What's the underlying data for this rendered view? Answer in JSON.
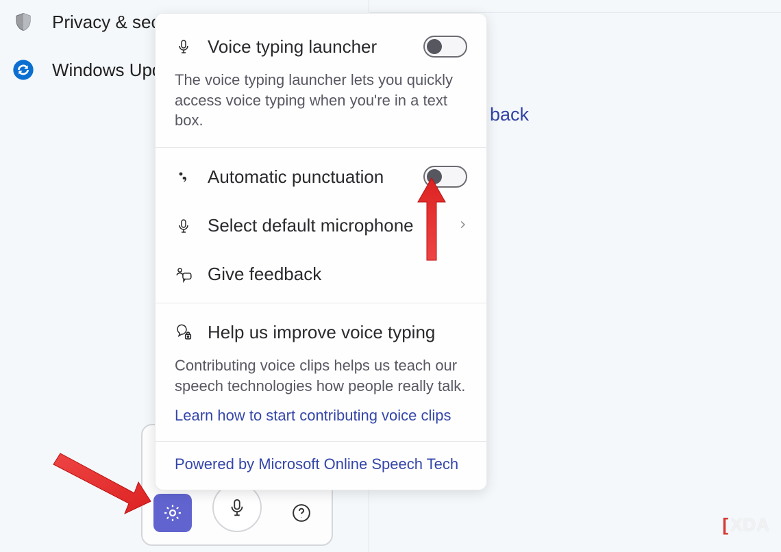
{
  "sidebar": {
    "privacy_label": "Privacy & security",
    "update_label": "Windows Update"
  },
  "back_link_fragment": "back",
  "voice_bar": {
    "settings_name": "gear-icon",
    "mic_name": "microphone-icon",
    "help_name": "question-mark-icon"
  },
  "popup": {
    "voice_launcher": {
      "title": "Voice typing launcher",
      "desc": "The voice typing launcher lets you quickly access voice typing when you're in a text box.",
      "toggle_state": "off"
    },
    "auto_punct": {
      "title": "Automatic punctuation",
      "toggle_state": "off"
    },
    "select_mic": {
      "title": "Select default microphone"
    },
    "feedback": {
      "title": "Give feedback"
    },
    "improve": {
      "title": "Help us improve voice typing",
      "desc": "Contributing voice clips helps us teach our speech technologies how people really talk.",
      "link": "Learn how to start contributing voice clips"
    },
    "footer": "Powered by Microsoft Online Speech Tech"
  },
  "watermark": "XDA"
}
